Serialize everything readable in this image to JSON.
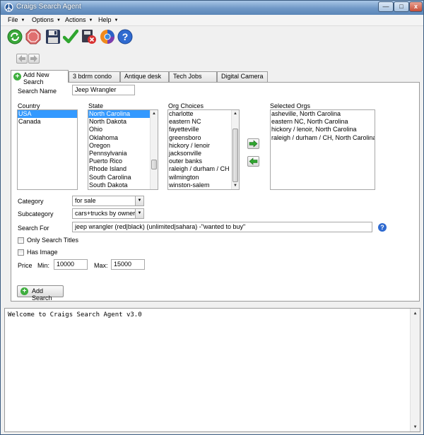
{
  "window": {
    "title": "Craigs Search Agent"
  },
  "menu": {
    "items": [
      "File",
      "Options",
      "Actions",
      "Help"
    ]
  },
  "tabs": [
    "Add New Search",
    "3 bdrm condo",
    "Antique desk",
    "Tech Jobs",
    "Digital Camera"
  ],
  "form": {
    "search_name_label": "Search Name",
    "search_name_value": "Jeep Wrangler",
    "country_label": "Country",
    "countries": [
      "USA",
      "Canada"
    ],
    "country_selected": "USA",
    "state_label": "State",
    "states": [
      "North Carolina",
      "North Dakota",
      "Ohio",
      "Oklahoma",
      "Oregon",
      "Pennsylvania",
      "Puerto Rico",
      "Rhode Island",
      "South Carolina",
      "South Dakota"
    ],
    "state_selected": "North Carolina",
    "org_choices_label": "Org Choices",
    "org_choices": [
      "charlotte",
      "eastern NC",
      "fayetteville",
      "greensboro",
      "hickory / lenoir",
      "jacksonville",
      "outer banks",
      "raleigh / durham / CH",
      "wilmington",
      "winston-salem"
    ],
    "selected_orgs_label": "Selected Orgs",
    "selected_orgs": [
      "asheville, North Carolina",
      "eastern NC, North Carolina",
      "hickory / lenoir, North Carolina",
      "raleigh / durham / CH, North Carolina"
    ],
    "category_label": "Category",
    "category_value": "for sale",
    "subcategory_label": "Subcategory",
    "subcategory_value": "cars+trucks by owner",
    "search_for_label": "Search For",
    "search_for_value": "jeep wrangler (red|black) (unlimited|sahara) -\"wanted to buy\"",
    "only_titles_label": "Only Search Titles",
    "only_titles_checked": false,
    "has_image_label": "Has Image",
    "has_image_checked": false,
    "price_label": "Price",
    "min_label": "Min:",
    "min_value": "10000",
    "max_label": "Max:",
    "max_value": "15000",
    "add_search_label": "Add Search"
  },
  "log": {
    "text": "Welcome to Craigs Search Agent v3.0"
  },
  "colors": {
    "selection": "#3399ff",
    "titlebar": "#6f98c6",
    "add_green": "#3fae3f",
    "help_blue": "#2f6ad0"
  },
  "icons": [
    "refresh-icon",
    "stop-icon",
    "save-icon",
    "checkmark-icon",
    "delete-icon",
    "browser-icon",
    "help-icon"
  ]
}
